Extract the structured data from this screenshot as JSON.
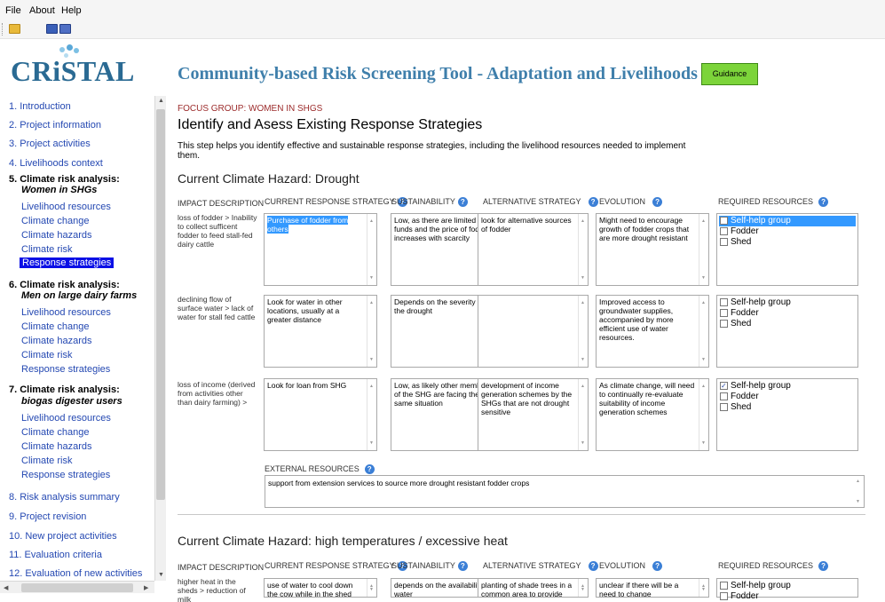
{
  "menu": {
    "file": "File",
    "about": "About",
    "help": "Help"
  },
  "toolbar": {
    "open_icon": "folder-open-icon",
    "save_icon": "floppy-disk-icon",
    "save_all_icon": "save-all-icon"
  },
  "logo_text": "CRiSTAL",
  "app_title": "Community-based Risk Screening Tool - Adaptation and Livelihoods",
  "guidance_button": "Guidance",
  "colors": {
    "guidance_bg": "#7cd43a",
    "nav_link": "#2448b2",
    "active_nav": "#0b10e6",
    "focus_group": "#9c2b2b",
    "title_blue": "#3f7fab"
  },
  "sidebar": {
    "items": [
      {
        "label": "1. Introduction"
      },
      {
        "label": "2. Project information"
      },
      {
        "label": "3. Project activities"
      },
      {
        "label": "4. Livelihoods context"
      },
      {
        "label": "5. Climate risk analysis:"
      },
      {
        "label": "Women in SHGs"
      },
      {
        "label": "Livelihood resources"
      },
      {
        "label": "Climate change"
      },
      {
        "label": "Climate hazards"
      },
      {
        "label": "Climate risk"
      },
      {
        "label": "Response strategies"
      },
      {
        "label": "6. Climate risk analysis:"
      },
      {
        "label": "Men on large dairy farms"
      },
      {
        "label": "Livelihood resources"
      },
      {
        "label": "Climate change"
      },
      {
        "label": "Climate hazards"
      },
      {
        "label": "Climate risk"
      },
      {
        "label": "Response strategies"
      },
      {
        "label": "7. Climate risk analysis:"
      },
      {
        "label": "biogas digester users"
      },
      {
        "label": "Livelihood resources"
      },
      {
        "label": "Climate change"
      },
      {
        "label": "Climate hazards"
      },
      {
        "label": "Climate risk"
      },
      {
        "label": "Response strategies"
      },
      {
        "label": "8. Risk analysis summary"
      },
      {
        "label": "9. Project revision"
      },
      {
        "label": "10. New project activities"
      },
      {
        "label": "11. Evaluation criteria"
      },
      {
        "label": "12. Evaluation of new activities"
      }
    ]
  },
  "main": {
    "focus_group": "FOCUS GROUP: WOMEN IN SHGS",
    "heading": "Identify and Asess Existing Response Strategies",
    "intro": "This step helps you identify effective and sustainable response strategies, including the livelihood resources needed to implement them.",
    "columns": {
      "impact": "IMPACT DESCRIPTION",
      "current": "CURRENT RESPONSE STRATEGY",
      "sustainability": "SUSTAINABILITY",
      "alternative": "ALTERNATIVE STRATEGY",
      "evolution": "EVOLUTION",
      "resources": "REQUIRED RESOURCES"
    },
    "help_icon": "?",
    "hazards": [
      {
        "title": "Current Climate Hazard: Drought",
        "rows": [
          {
            "impact": "loss of fodder > Inability to collect sufficent fodder to feed stall-fed dairy cattle",
            "current": "Purchase of fodder from others",
            "sustainability": "Low, as there are limited funds and the price of fodder increases with scarcity",
            "alternative": "look for alternative sources of fodder",
            "evolution": "Might need to encourage growth of fodder crops that are more drought resistant",
            "resources": [
              {
                "label": "Self-help group",
                "checked": false,
                "highlighted": true
              },
              {
                "label": "Fodder",
                "checked": false,
                "highlighted": false
              },
              {
                "label": "Shed",
                "checked": false,
                "highlighted": false
              }
            ]
          },
          {
            "impact": "declining flow of surface water > lack of water for stall fed cattle",
            "current": "Look for water in other locations, usually at a greater distance",
            "sustainability": "Depends on the severity of the drought",
            "alternative": "",
            "evolution": "Improved access to groundwater supplies, accompanied by more efficient use of water resources.",
            "resources": [
              {
                "label": "Self-help group",
                "checked": false,
                "highlighted": false
              },
              {
                "label": "Fodder",
                "checked": false,
                "highlighted": false
              },
              {
                "label": "Shed",
                "checked": false,
                "highlighted": false
              }
            ]
          },
          {
            "impact": "loss of income (derived from activities other than dairy farming) >",
            "current": "Look for loan from SHG",
            "sustainability": "Low, as likely other members of the SHG are facing the same situation",
            "alternative": "development of income generation schemes by the SHGs that are not drought sensitive",
            "evolution": "As climate change, will need to continually re-evaluate suitability of income generation schemes",
            "resources": [
              {
                "label": "Self-help group",
                "checked": true,
                "highlighted": false
              },
              {
                "label": "Fodder",
                "checked": false,
                "highlighted": false
              },
              {
                "label": "Shed",
                "checked": false,
                "highlighted": false
              }
            ]
          }
        ],
        "external_label": "EXTERNAL RESOURCES",
        "external": "support from extension services to source more drought resistant fodder crops"
      },
      {
        "title": "Current Climate Hazard: high temperatures / excessive heat",
        "rows": [
          {
            "impact": "higher heat in the sheds > reduction of milk",
            "current": "use of water to cool down the cow while in the shed",
            "sustainability": "depends on the availability of water",
            "alternative": "planting of shade trees in a common area to provide more",
            "evolution": "unclear if there will be a need to change",
            "resources": [
              {
                "label": "Self-help group",
                "checked": false,
                "highlighted": false
              },
              {
                "label": "Fodder",
                "checked": false,
                "highlighted": false
              }
            ]
          }
        ]
      }
    ]
  }
}
